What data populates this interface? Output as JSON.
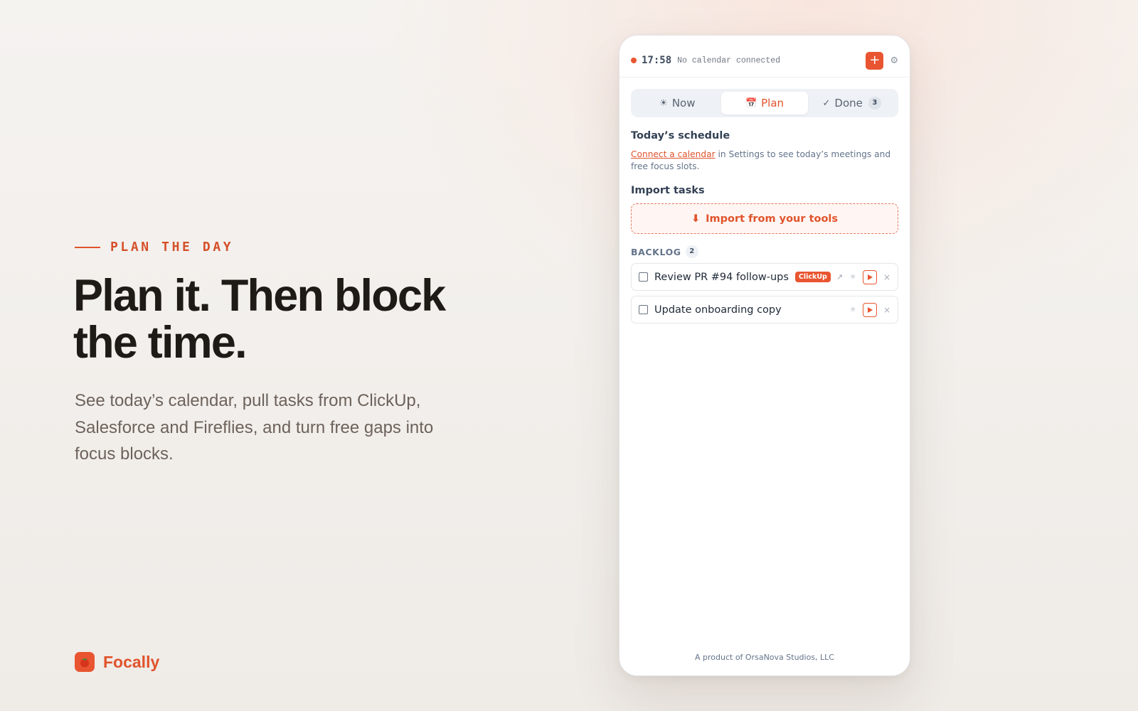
{
  "hero": {
    "eyebrow": "PLAN THE DAY",
    "headline": "Plan it. Then block the time.",
    "subhead": "See today’s calendar, pull tasks from ClickUp, Salesforce and Fireflies, and turn free gaps into focus blocks."
  },
  "brand": {
    "name": "Focally",
    "logo_icon": "tomato-icon",
    "accent": "#e0532c"
  },
  "app": {
    "topbar": {
      "time": "17:58",
      "calendar_status": "No calendar connected",
      "add_label": "+",
      "settings_icon": "gear-icon",
      "settings_glyph": "⚙"
    },
    "tabs": [
      {
        "glyph": "☀",
        "label": "Now",
        "active": false
      },
      {
        "glyph": "📅",
        "label": "Plan",
        "active": true
      },
      {
        "glyph": "✓",
        "label": "Done",
        "count": "3",
        "active": false
      }
    ],
    "schedule": {
      "title": "Today’s schedule",
      "link_text": "Connect a calendar",
      "note_rest": " in Settings to see today’s meetings and free focus slots."
    },
    "import": {
      "title": "Import tasks",
      "button_glyph": "⬇",
      "button_label": "Import from your tools"
    },
    "backlog": {
      "title": "BACKLOG",
      "count": "2",
      "tasks": [
        {
          "title": "Review PR #94 follow-ups",
          "tag": "ClickUp",
          "open_glyph": "↗",
          "focus_glyph": "☀",
          "close_glyph": "×"
        },
        {
          "title": "Update onboarding copy",
          "focus_glyph": "☀",
          "close_glyph": "×"
        }
      ]
    },
    "footer": "A product of OrsaNova Studios, LLC"
  }
}
